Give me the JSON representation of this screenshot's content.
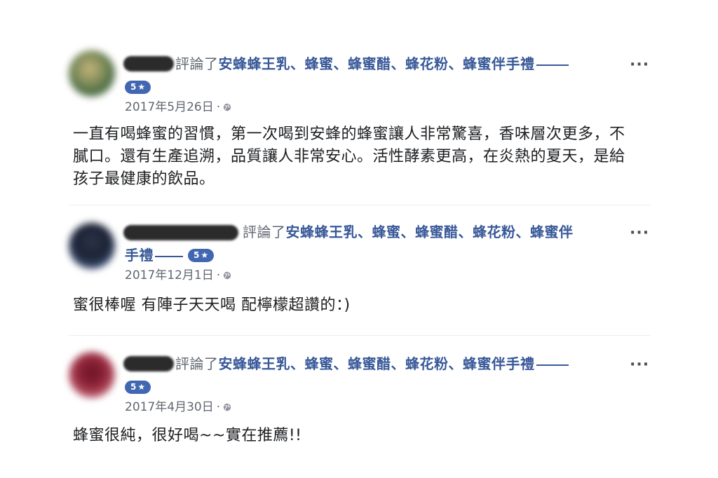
{
  "reviews": [
    {
      "reviewed_text": "評論了",
      "page_name": "安蜂蜂王乳、蜂蜜、蜂蜜醋、蜂花粉、蜂蜜伴手禮",
      "rating": "5",
      "date": "2017年5月26日",
      "dot": "·",
      "text": "一直有喝蜂蜜的習慣，第一次喝到安蜂的蜂蜜讓人非常驚喜，香味層次更多，不\n膩口。還有生產追溯，品質讓人非常安心。活性酵素更高，在炎熱的夏天，是給\n孩子最健康的飲品。"
    },
    {
      "reviewed_text": "評論了",
      "page_name_line1": "安蜂蜂王乳、蜂蜜、蜂蜜醋、蜂花粉、蜂蜜伴",
      "page_name_line2": "手禮",
      "rating": "5",
      "date": "2017年12月1日",
      "dot": "·",
      "text": "蜜很棒喔 有陣子天天喝 配檸檬超讚的：)"
    },
    {
      "reviewed_text": "評論了",
      "page_name": "安蜂蜂王乳、蜂蜜、蜂蜜醋、蜂花粉、蜂蜜伴手禮",
      "rating": "5",
      "date": "2017年4月30日",
      "dot": "·",
      "text": "蜂蜜很純，很好喝~~實在推薦!!"
    }
  ],
  "labels": {
    "more": "···",
    "star": "★"
  },
  "icons": {
    "rating": "star-icon",
    "privacy": "globe-icon",
    "options": "more-options-icon"
  },
  "colors": {
    "link": "#385898",
    "badge": "#4267b2",
    "meta": "#606770",
    "text": "#1c1e21"
  }
}
